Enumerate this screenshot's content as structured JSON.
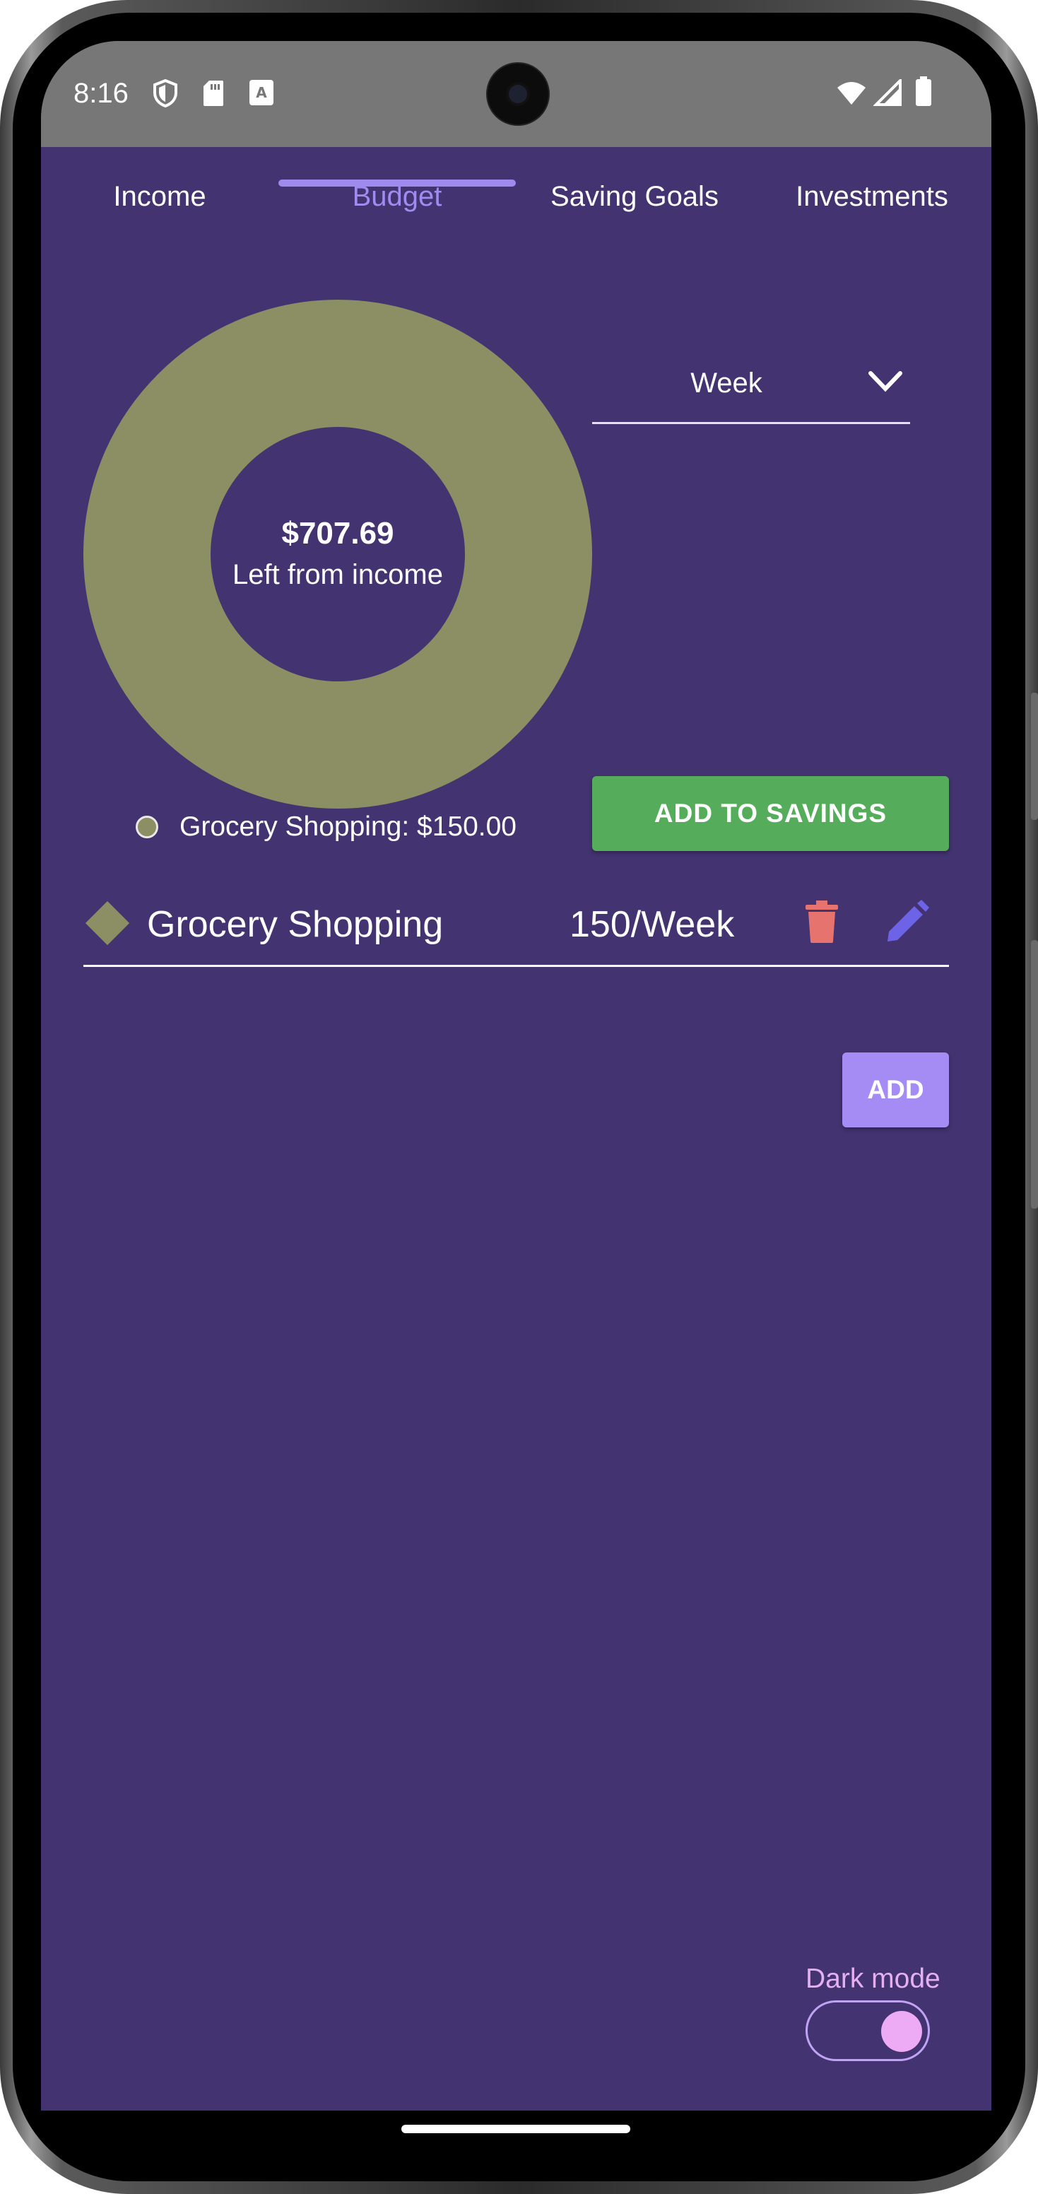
{
  "status_bar": {
    "time": "8:16"
  },
  "tabs": [
    {
      "label": "Income",
      "active": false
    },
    {
      "label": "Budget",
      "active": true
    },
    {
      "label": "Saving Goals",
      "active": false
    },
    {
      "label": "Investments",
      "active": false
    }
  ],
  "donut": {
    "amount": "$707.69",
    "label": "Left from income",
    "color": "#8b8f63"
  },
  "legend": {
    "text": "Grocery Shopping: $150.00"
  },
  "period_dropdown": {
    "value": "Week"
  },
  "buttons": {
    "add_to_savings": "ADD TO SAVINGS",
    "add": "ADD"
  },
  "budget_items": [
    {
      "name": "Grocery Shopping",
      "amount": "150/Week",
      "color": "#8b8f63"
    }
  ],
  "dark_mode": {
    "label": "Dark mode",
    "enabled": true
  },
  "colors": {
    "background": "#433370",
    "accent": "#a08cf0",
    "savings_button": "#55ad5b",
    "delete_icon": "#e6736e",
    "edit_icon": "#6c63e6"
  }
}
